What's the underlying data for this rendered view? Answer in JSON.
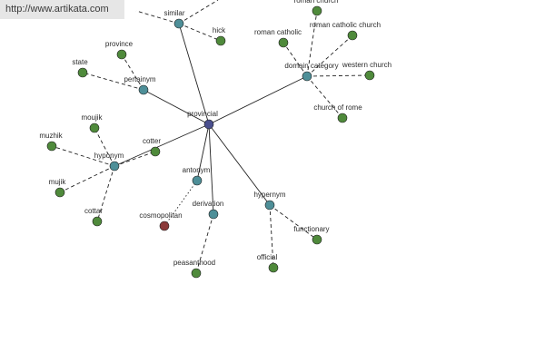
{
  "watermark": "http://www.artikata.com",
  "colors": {
    "center": "#4a4f8e",
    "relation": "#4e8f98",
    "leaf": "#4f8a3b",
    "antonym_leaf": "#8b3a3a",
    "edge": "#222222"
  },
  "nodes": [
    {
      "id": "provincial",
      "label": "provincial",
      "kind": "center"
    },
    {
      "id": "similar",
      "label": "similar",
      "kind": "relation"
    },
    {
      "id": "domain_category",
      "label": "domain category",
      "kind": "relation"
    },
    {
      "id": "pertainym",
      "label": "pertainym",
      "kind": "relation"
    },
    {
      "id": "hyponym",
      "label": "hyponym",
      "kind": "relation"
    },
    {
      "id": "antonym",
      "label": "antonym",
      "kind": "relation"
    },
    {
      "id": "derivation",
      "label": "derivation",
      "kind": "relation"
    },
    {
      "id": "hypernym",
      "label": "hypernym",
      "kind": "relation"
    },
    {
      "id": "hick",
      "label": "hick",
      "kind": "leaf"
    },
    {
      "id": "roman_church",
      "label": "roman church",
      "kind": "leaf"
    },
    {
      "id": "roman_catholic_church",
      "label": "roman catholic church",
      "kind": "leaf"
    },
    {
      "id": "roman_catholic",
      "label": "roman catholic",
      "kind": "leaf"
    },
    {
      "id": "western_church",
      "label": "western church",
      "kind": "leaf"
    },
    {
      "id": "church_of_rome",
      "label": "church of rome",
      "kind": "leaf"
    },
    {
      "id": "province",
      "label": "province",
      "kind": "leaf"
    },
    {
      "id": "state",
      "label": "state",
      "kind": "leaf"
    },
    {
      "id": "moujik",
      "label": "moujik",
      "kind": "leaf"
    },
    {
      "id": "muzhik",
      "label": "muzhik",
      "kind": "leaf"
    },
    {
      "id": "cotter",
      "label": "cotter",
      "kind": "leaf"
    },
    {
      "id": "mujik",
      "label": "mujik",
      "kind": "leaf"
    },
    {
      "id": "cottar",
      "label": "cottar",
      "kind": "leaf"
    },
    {
      "id": "cosmopolitan",
      "label": "cosmopolitan",
      "kind": "antonym_leaf"
    },
    {
      "id": "peasanthood",
      "label": "peasanthood",
      "kind": "leaf"
    },
    {
      "id": "functionary",
      "label": "functionary",
      "kind": "leaf"
    },
    {
      "id": "official",
      "label": "official",
      "kind": "leaf"
    }
  ],
  "edges": [
    {
      "from": "provincial",
      "to": "similar",
      "style": "solid"
    },
    {
      "from": "provincial",
      "to": "domain_category",
      "style": "solid"
    },
    {
      "from": "provincial",
      "to": "pertainym",
      "style": "solid"
    },
    {
      "from": "provincial",
      "to": "hyponym",
      "style": "solid"
    },
    {
      "from": "provincial",
      "to": "antonym",
      "style": "solid"
    },
    {
      "from": "provincial",
      "to": "derivation",
      "style": "solid"
    },
    {
      "from": "provincial",
      "to": "hypernym",
      "style": "solid"
    },
    {
      "from": "similar",
      "to": "hick",
      "style": "dashed"
    },
    {
      "from": "domain_category",
      "to": "roman_church",
      "style": "dashed"
    },
    {
      "from": "domain_category",
      "to": "roman_catholic_church",
      "style": "dashed"
    },
    {
      "from": "domain_category",
      "to": "roman_catholic",
      "style": "dashed"
    },
    {
      "from": "domain_category",
      "to": "western_church",
      "style": "dashed"
    },
    {
      "from": "domain_category",
      "to": "church_of_rome",
      "style": "dashed"
    },
    {
      "from": "pertainym",
      "to": "province",
      "style": "dashed"
    },
    {
      "from": "pertainym",
      "to": "state",
      "style": "dashed"
    },
    {
      "from": "hyponym",
      "to": "moujik",
      "style": "dashed"
    },
    {
      "from": "hyponym",
      "to": "muzhik",
      "style": "dashed"
    },
    {
      "from": "hyponym",
      "to": "cotter",
      "style": "dashed"
    },
    {
      "from": "hyponym",
      "to": "mujik",
      "style": "dashed"
    },
    {
      "from": "hyponym",
      "to": "cottar",
      "style": "dashed"
    },
    {
      "from": "antonym",
      "to": "cosmopolitan",
      "style": "dotted"
    },
    {
      "from": "derivation",
      "to": "peasanthood",
      "style": "dashed"
    },
    {
      "from": "hypernym",
      "to": "functionary",
      "style": "dashed"
    },
    {
      "from": "hypernym",
      "to": "official",
      "style": "dashed"
    }
  ]
}
